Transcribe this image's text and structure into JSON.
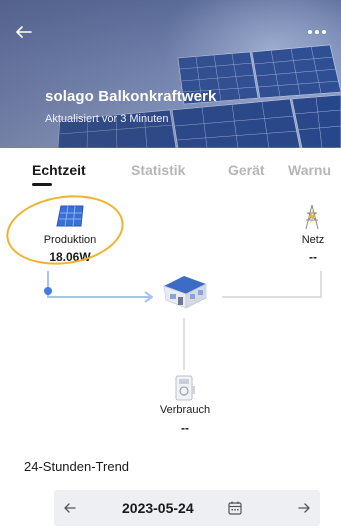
{
  "header": {
    "title": "solago Balkonkraftwerk",
    "subtitle": "Aktualisiert vor 3 Minuten",
    "back_icon": "arrow-left-icon",
    "more_icon": "more-dots-icon"
  },
  "tabs": [
    {
      "label": "Echtzeit",
      "active": true
    },
    {
      "label": "Statistik",
      "active": false
    },
    {
      "label": "Gerät",
      "active": false
    },
    {
      "label": "Warnu",
      "active": false
    }
  ],
  "flow": {
    "production": {
      "label": "Produktion",
      "value": "18.06W",
      "icon": "solar-panel-icon"
    },
    "grid": {
      "label": "Netz",
      "value": "--",
      "icon": "power-tower-icon"
    },
    "home": {
      "icon": "house-icon"
    },
    "consumption": {
      "label": "Verbrauch",
      "value": "--",
      "icon": "meter-icon"
    }
  },
  "trend": {
    "title": "24-Stunden-Trend",
    "date": "2023-05-24",
    "prev_icon": "arrow-left-icon",
    "next_icon": "arrow-right-icon",
    "calendar_icon": "calendar-icon"
  },
  "colors": {
    "flow_active": "#a9c3f0",
    "flow_inactive": "#dedede",
    "highlight": "#f0b32e"
  }
}
